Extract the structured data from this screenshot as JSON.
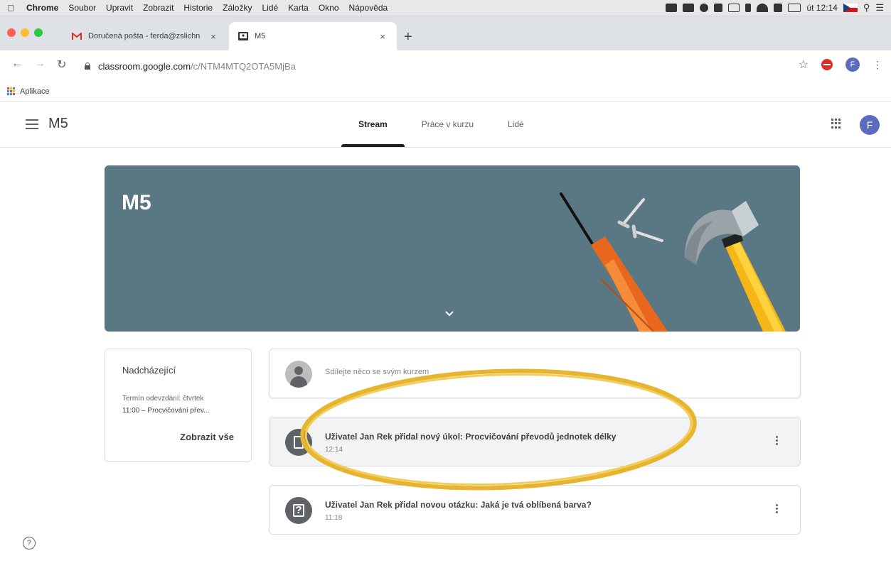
{
  "menubar": {
    "apple_icon": "apple-icon",
    "items": [
      "Chrome",
      "Soubor",
      "Upravit",
      "Zobrazit",
      "Historie",
      "Záložky",
      "Lidé",
      "Karta",
      "Okno",
      "Nápověda"
    ],
    "clock": "út 12:14"
  },
  "browser": {
    "tabs": [
      {
        "title": "Doručená pošta - ferda@zslichn",
        "icon": "gmail-icon"
      },
      {
        "title": "M5",
        "icon": "classroom-icon"
      }
    ],
    "close_glyph": "×",
    "new_tab_glyph": "+",
    "url_host": "classroom.google.com",
    "url_path": "/c/NTM4MTQ2OTA5MjBa",
    "profile_initial": "F",
    "bookmarks_label": "Aplikace"
  },
  "classroom": {
    "class_name": "M5",
    "tabs": [
      "Stream",
      "Práce v kurzu",
      "Lidé"
    ],
    "active_tab": "Stream",
    "avatar_initial": "F",
    "banner_title": "M5",
    "upcoming": {
      "title": "Nadcházející",
      "due_line": "Termín odevzdání: čtvrtek",
      "item_line": "11:00 – Procvičování přev...",
      "link": "Zobrazit vše"
    },
    "announce_placeholder": "Sdílejte něco se svým kurzem",
    "posts": [
      {
        "title": "Uživatel Jan Rek přidal nový úkol: Procvičování převodů jednotek délky",
        "time": "12:14",
        "icon": "assignment-icon"
      },
      {
        "title": "Uživatel Jan Rek přidal novou otázku: Jaká je tvá oblíbená barva?",
        "time": "11:18",
        "icon": "question-icon"
      }
    ],
    "help_glyph": "?"
  },
  "colors": {
    "banner": "#5a7883",
    "highlight_ring": "#e6b42e",
    "avatar": "#5c6bc0"
  }
}
